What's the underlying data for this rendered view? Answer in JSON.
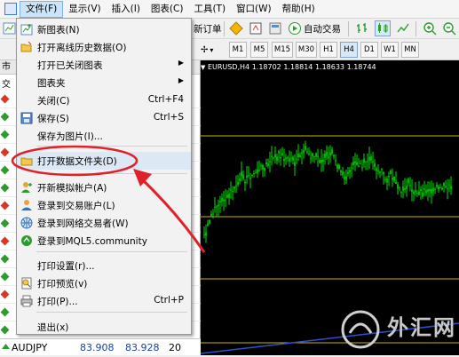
{
  "menubar": {
    "items": [
      "文件(F)",
      "显示(V)",
      "插入(I)",
      "图表(C)",
      "工具(T)",
      "窗口(W)",
      "帮助(H)"
    ]
  },
  "toolbar": {
    "new_order": "新订单",
    "auto_trading": "自动交易",
    "timeframes": [
      "M1",
      "M5",
      "M15",
      "M30",
      "H1",
      "H4",
      "D1",
      "W1",
      "MN"
    ],
    "active_timeframe": "H4"
  },
  "navigator": {
    "header_left": "市",
    "header_sub": "交",
    "rows_count_note": ""
  },
  "file_menu": {
    "items": [
      {
        "label": "新图表(N)",
        "shortcut": "",
        "submenu": false,
        "icon": "new-chart-icon"
      },
      {
        "label": "打开离线历史数据(O)",
        "shortcut": "",
        "submenu": false,
        "icon": "open-folder-icon"
      },
      {
        "label": "打开已关闭图表",
        "shortcut": "",
        "submenu": true,
        "icon": ""
      },
      {
        "label": "图表夹",
        "shortcut": "",
        "submenu": true,
        "icon": ""
      },
      {
        "label": "关闭(C)",
        "shortcut": "Ctrl+F4",
        "submenu": false,
        "icon": ""
      },
      {
        "label": "保存(S)",
        "shortcut": "Ctrl+S",
        "submenu": false,
        "icon": "save-icon"
      },
      {
        "label": "保存为图片(I)...",
        "shortcut": "",
        "submenu": false,
        "icon": ""
      },
      {
        "label": "打开数据文件夹(D)",
        "shortcut": "",
        "submenu": false,
        "icon": "folder-icon"
      },
      {
        "label": "开新模拟帐户(A)",
        "shortcut": "",
        "submenu": false,
        "icon": "user-add-icon"
      },
      {
        "label": "登录到交易账户(L)",
        "shortcut": "",
        "submenu": false,
        "icon": "user-icon"
      },
      {
        "label": "登录到网络交易者(W)",
        "shortcut": "",
        "submenu": false,
        "icon": "globe-icon"
      },
      {
        "label": "登录到MQL5.community",
        "shortcut": "",
        "submenu": false,
        "icon": "mql5-icon"
      },
      {
        "label": "打印设置(r)...",
        "shortcut": "",
        "submenu": false,
        "icon": ""
      },
      {
        "label": "打印预览(v)",
        "shortcut": "",
        "submenu": false,
        "icon": "print-preview-icon"
      },
      {
        "label": "打印(P)...",
        "shortcut": "Ctrl+P",
        "submenu": false,
        "icon": "printer-icon"
      },
      {
        "label": "退出(x)",
        "shortcut": "",
        "submenu": false,
        "icon": ""
      }
    ]
  },
  "chart": {
    "title": "EURUSD,H4  1.18702 1.18814 1.18633 1.18744"
  },
  "quote": {
    "symbol": "AUDJPY",
    "bid": "83.908",
    "ask": "83.928",
    "spread": "20"
  },
  "watermark": {
    "text": "外汇网"
  },
  "colors": {
    "up": "#2e9b2e",
    "down": "#d33a2c",
    "annotation": "#e0202a",
    "candle": "#00e000",
    "level": "#c8b400"
  }
}
